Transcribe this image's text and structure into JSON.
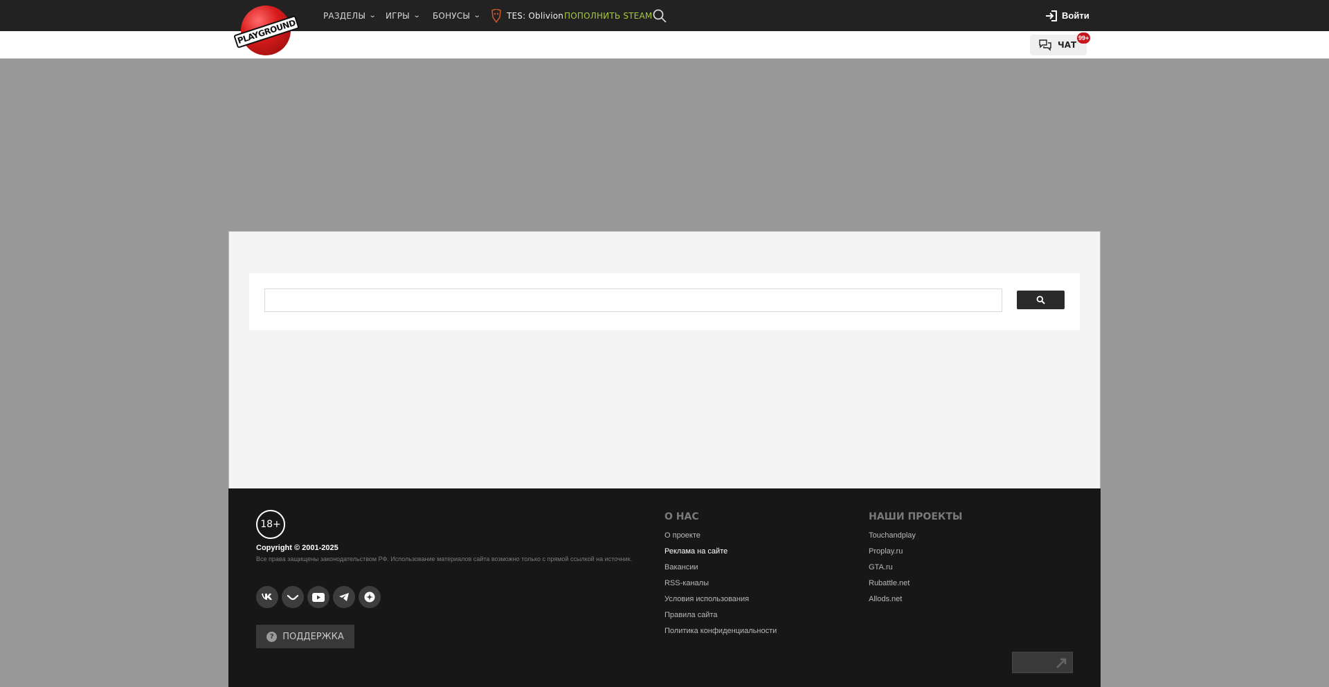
{
  "header": {
    "logo_text": "PLAYGROUND",
    "nav": [
      {
        "label": "РАЗДЕЛЫ"
      },
      {
        "label": "ИГРЫ"
      },
      {
        "label": "БОНУСЫ"
      }
    ],
    "game_link": "TES: Oblivion",
    "steam_link": "ПОПОЛНИТЬ STEAM",
    "login_label": "Войти",
    "chat_label": "ЧАТ",
    "chat_badge": "99+"
  },
  "search": {
    "placeholder": "",
    "value": ""
  },
  "footer": {
    "age_rating": "18+",
    "copyright": "Copyright © 2001-2025",
    "rights_text": "Все права защищены законодательством РФ. Использование материалов сайта возможно только с прямой ссылкой на источник.",
    "socials": [
      "vk-icon",
      "steam-icon",
      "youtube-icon",
      "telegram-icon",
      "zen-icon"
    ],
    "support_label": "ПОДДЕРЖКА",
    "about_title": "О НАС",
    "about_links": [
      "О проекте",
      "Реклама на сайте",
      "Вакансии",
      "RSS-каналы",
      "Условия использования",
      "Правила сайта",
      "Политика конфиденциальности"
    ],
    "projects_title": "НАШИ ПРОЕКТЫ",
    "project_links": [
      "Touchandplay",
      "Proplay.ru",
      "GTA.ru",
      "Rubattle.net",
      "Allods.net"
    ]
  },
  "colors": {
    "topbar": "#222222",
    "steam_accent": "#a8c93a",
    "badge": "#c8141a",
    "footer": "#171717"
  }
}
